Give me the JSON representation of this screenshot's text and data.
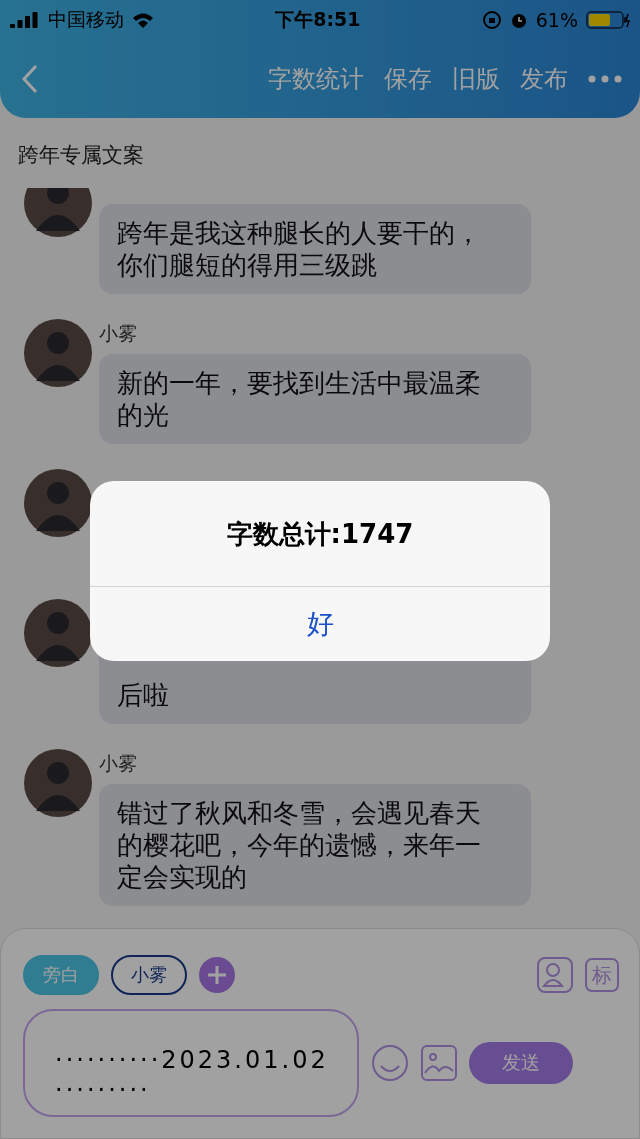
{
  "status_bar": {
    "carrier": "中国移动",
    "time": "下午8:51",
    "battery": "61%"
  },
  "header": {
    "actions": [
      "字数统计",
      "保存",
      "旧版",
      "发布"
    ]
  },
  "title": "跨年专属文案",
  "messages": [
    {
      "kind": "full",
      "text": "跨年是我这种腿长的人要干的，你们腿短的得用三级跳"
    },
    {
      "kind": "full",
      "name": "小雾",
      "text": "新的一年，要找到生活中最温柔的光"
    },
    {
      "kind": "covered"
    },
    {
      "kind": "partial",
      "text": "后啦"
    },
    {
      "kind": "full",
      "name": "小雾",
      "text": "错过了秋风和冬雪，会遇见春天的樱花吧，今年的遗憾，来年一定会实现的"
    }
  ],
  "speakers": [
    {
      "label": "旁白",
      "selected": true
    },
    {
      "label": "小雾",
      "selected": false
    }
  ],
  "mark_button": "标",
  "input": {
    "value": "··········2023.01.02·········"
  },
  "send_button": "发送",
  "alert": {
    "message": "字数总计:1747",
    "button": "好"
  }
}
